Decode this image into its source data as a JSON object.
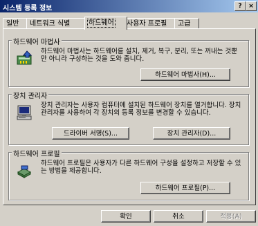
{
  "window": {
    "title": "시스템 등록 정보",
    "help_label": "?",
    "close_label": "×"
  },
  "tabs": [
    {
      "label": "일반",
      "active": false
    },
    {
      "label": "네트워크 식별",
      "active": false
    },
    {
      "label": "하드웨어",
      "active": true
    },
    {
      "label": "사용자 프로필",
      "active": false
    },
    {
      "label": "고급",
      "active": false
    }
  ],
  "groups": {
    "wizard": {
      "title": "하드웨어 마법사",
      "description": "하드웨어 마법사는 하드웨어를 설치, 제거, 복구, 분리, 또는 꺼내는 것뿐만 아니라 구성하는 것을 도와 줍니다.",
      "button": "하드웨어 마법사(H)..."
    },
    "device_manager": {
      "title": "장치 관리자",
      "description": "장치 관리자는 사용자 컴퓨터에 설치된 하드웨어 장치를 열거합니다. 장치 관리자를 사용하여 각 장치의 등록 정보를 변경할 수 있습니다.",
      "button_signing": "드라이버 서명(S)...",
      "button_manager": "장치 관리자(D)..."
    },
    "profiles": {
      "title": "하드웨어 프로필",
      "description": "하드웨어 프로필은 사용자가 다른 하드웨어 구성을 설정하고 저장할 수 있는 방법을 제공합니다.",
      "button": "하드웨어 프로필(P)..."
    }
  },
  "footer": {
    "ok": "확인",
    "cancel": "취소",
    "apply": "적용(A)"
  }
}
